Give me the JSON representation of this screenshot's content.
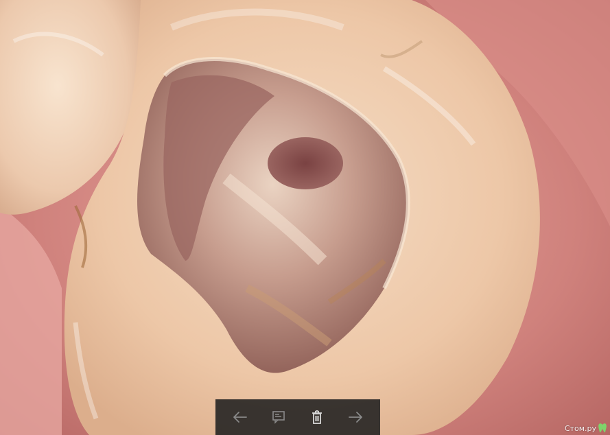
{
  "photo": {
    "subject": "tooth-cavity-photo"
  },
  "toolbar": {
    "icons": {
      "previous": "arrow-left-icon",
      "slideshow": "slideshow-icon",
      "delete": "trash-icon",
      "next": "arrow-right-icon"
    },
    "colors": {
      "background": "#202020",
      "icon": "#8a8a8a",
      "icon_active": "#d8d8d8"
    }
  },
  "watermark": {
    "text": "Стом.ру",
    "logo_color": "#7fd36b"
  }
}
